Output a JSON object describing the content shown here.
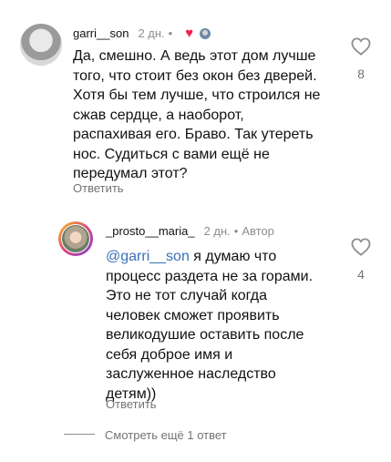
{
  "comments": [
    {
      "username": "garri__son",
      "time": "2 дн.",
      "text_lines": [
        "Да, смешно.  А ведь этот дом лучше",
        "того, что стоит без окон без дверей.",
        "Хотя бы тем лучше,  что строился не",
        "сжав сердце,  а наоборот,",
        "распахивая его. Браво. Так утереть",
        "нос. Судиться с вами ещё не",
        "передумал этот?"
      ],
      "reply_label": "Ответить",
      "likes": "8",
      "heart_icon": "heart-filled-icon",
      "heart_color": "#ed2456"
    },
    {
      "username": "_prosto__maria_",
      "time": "2 дн.",
      "author_label": "Автор",
      "mention": "@garri__son",
      "text_lines": [
        " я думаю что",
        "процесс раздета не за горами.",
        "Это не тот случай когда",
        "человек сможет проявить",
        "великодушие оставить после",
        "себя доброе имя и",
        "заслуженное наследство",
        "детям))"
      ],
      "reply_label": "Ответить",
      "likes": "4"
    }
  ],
  "more_replies_label": "Смотреть ещё 1 ответ",
  "colors": {
    "mention": "#3b6fb6",
    "muted": "#737373"
  }
}
